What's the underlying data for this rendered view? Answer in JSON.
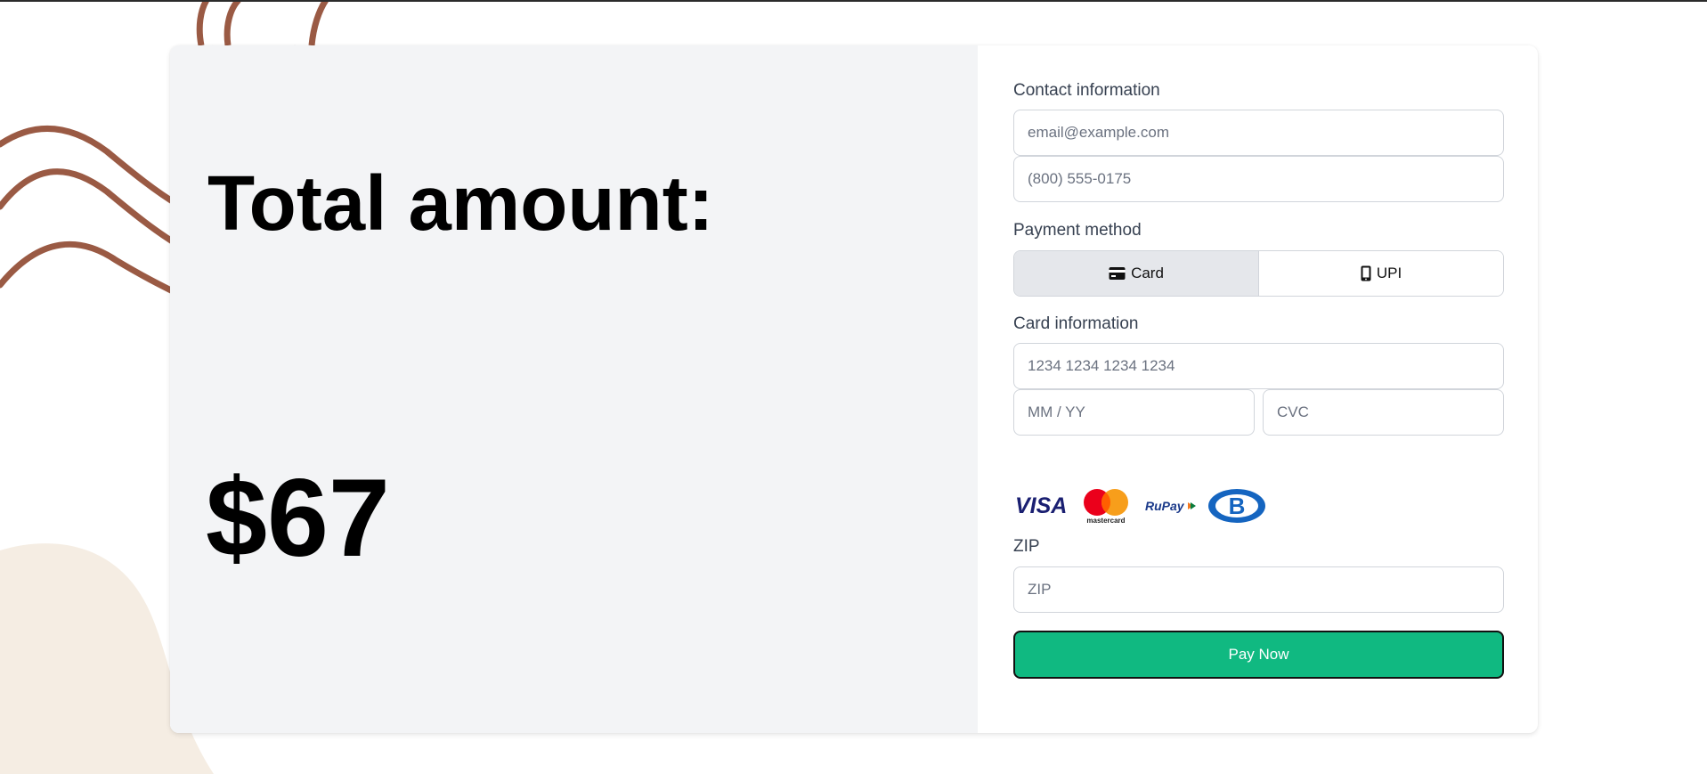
{
  "summary": {
    "total_label": "Total amount:",
    "total_value": "$67"
  },
  "contact": {
    "label": "Contact information",
    "email_placeholder": "email@example.com",
    "phone_placeholder": "(800) 555-0175"
  },
  "payment_method": {
    "label": "Payment method",
    "options": [
      {
        "label": "Card",
        "icon": "credit-card-icon",
        "selected": true
      },
      {
        "label": "UPI",
        "icon": "mobile-phone-icon",
        "selected": false
      }
    ]
  },
  "card_info": {
    "label": "Card information",
    "number_placeholder": "1234 1234 1234 1234",
    "expiry_placeholder": "MM / YY",
    "cvc_placeholder": "CVC",
    "brands": [
      {
        "name": "visa-logo",
        "text": "VISA"
      },
      {
        "name": "mastercard-logo",
        "text": "mastercard"
      },
      {
        "name": "rupay-logo",
        "text": "RuPay"
      },
      {
        "name": "bank-logo",
        "text": "B"
      }
    ]
  },
  "zip": {
    "label": "ZIP",
    "placeholder": "ZIP"
  },
  "actions": {
    "pay_label": "Pay Now"
  },
  "colors": {
    "pay_button": "#10b981",
    "left_panel": "#f3f4f6",
    "decor_stroke": "#9a5a44",
    "decor_blob": "#f5ede3"
  }
}
